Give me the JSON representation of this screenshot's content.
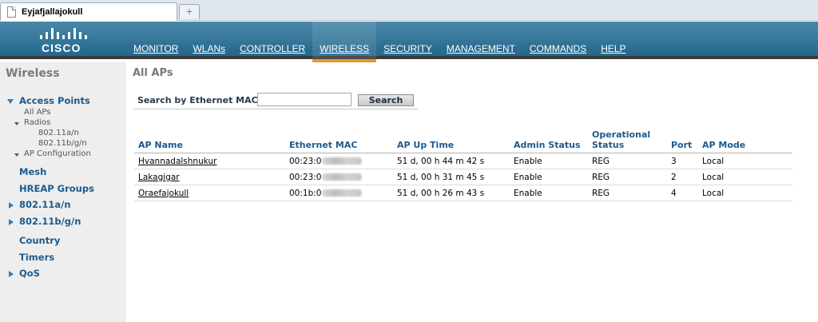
{
  "browser": {
    "tab_title": "Eyjafjallajokull",
    "new_tab_glyph": "+"
  },
  "header": {
    "logo_text": "CISCO",
    "nav": [
      {
        "label": "MONITOR"
      },
      {
        "label": "WLANs"
      },
      {
        "label": "CONTROLLER"
      },
      {
        "label": "WIRELESS",
        "active": true
      },
      {
        "label": "SECURITY"
      },
      {
        "label": "MANAGEMENT"
      },
      {
        "label": "COMMANDS"
      },
      {
        "label": "HELP"
      }
    ]
  },
  "sidebar": {
    "title": "Wireless",
    "access_points": {
      "label": "Access Points",
      "all_aps": "All APs",
      "radios": "Radios",
      "radio_a": "802.11a/n",
      "radio_bg": "802.11b/g/n",
      "ap_configuration": "AP Configuration"
    },
    "items": [
      {
        "label": "Mesh"
      },
      {
        "label": "HREAP Groups"
      },
      {
        "label": "802.11a/n"
      },
      {
        "label": "802.11b/g/n"
      },
      {
        "label": "Country"
      },
      {
        "label": "Timers"
      },
      {
        "label": "QoS"
      }
    ]
  },
  "main": {
    "title": "All APs",
    "search": {
      "label": "Search by Ethernet MAC",
      "value": "",
      "button": "Search"
    },
    "table": {
      "headers": [
        "AP Name",
        "Ethernet MAC",
        "AP Up Time",
        "Admin Status",
        "Operational Status",
        "Port",
        "AP Mode"
      ],
      "rows": [
        {
          "name": "Hvannadalshnukur",
          "mac": "00:23:0",
          "uptime": "51 d, 00 h 44 m 42 s",
          "admin": "Enable",
          "oper": "REG",
          "port": "3",
          "mode": "Local"
        },
        {
          "name": "Lakagigar",
          "mac": "00:23:0",
          "uptime": "51 d, 00 h 31 m 45 s",
          "admin": "Enable",
          "oper": "REG",
          "port": "2",
          "mode": "Local"
        },
        {
          "name": "Oraefajokull",
          "mac": "00:1b:0",
          "uptime": "51 d, 00 h 26 m 43 s",
          "admin": "Enable",
          "oper": "REG",
          "port": "4",
          "mode": "Local"
        }
      ]
    }
  },
  "colors": {
    "header": "#23678b",
    "accent": "#e9982c",
    "link": "#1d5a8c"
  }
}
